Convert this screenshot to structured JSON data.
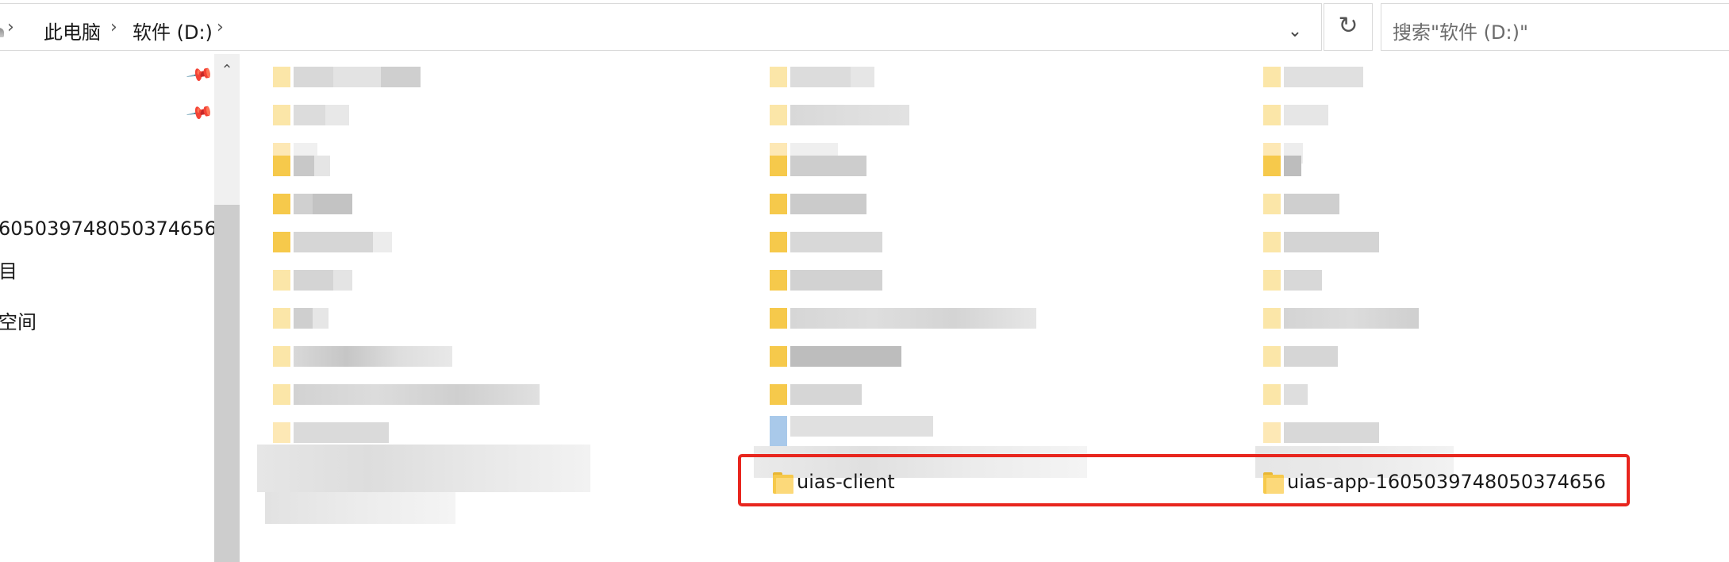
{
  "address_bar": {
    "breadcrumbs": [
      "此电脑",
      "软件 (D:)"
    ],
    "search_placeholder": "搜索\"软件 (D:)\"",
    "refresh_icon": "refresh-icon",
    "history_icon": "chevron-down-icon"
  },
  "nav": {
    "items": [
      {
        "label": "605039748050374656"
      },
      {
        "label": "目"
      },
      {
        "label": "空间"
      }
    ],
    "pin_icon": "pin-icon"
  },
  "content": {
    "visible_folders": [
      {
        "name": "uias-client"
      },
      {
        "name": "uias-app-1605039748050374656"
      }
    ],
    "highlight_color": "#e8261e"
  }
}
